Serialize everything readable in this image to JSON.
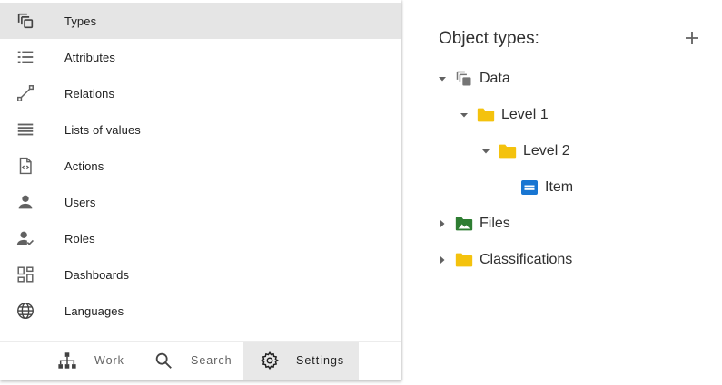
{
  "nav": {
    "items": [
      {
        "label": "Types",
        "icon": "types-icon",
        "active": true
      },
      {
        "label": "Attributes",
        "icon": "attributes-list-icon"
      },
      {
        "label": "Relations",
        "icon": "relations-icon"
      },
      {
        "label": "Lists of values",
        "icon": "lists-icon"
      },
      {
        "label": "Actions",
        "icon": "actions-file-code-icon"
      },
      {
        "label": "Users",
        "icon": "user-icon"
      },
      {
        "label": "Roles",
        "icon": "roles-user-check-icon"
      },
      {
        "label": "Dashboards",
        "icon": "dashboard-icon"
      },
      {
        "label": "Languages",
        "icon": "globe-icon"
      }
    ]
  },
  "bottom_nav": {
    "work": "Work",
    "search": "Search",
    "settings": "Settings",
    "active": "settings"
  },
  "object_types": {
    "title": "Object types:",
    "add_icon": "plus-icon",
    "tree": [
      {
        "label": "Data",
        "icon": "types-filled-icon",
        "expanded": true
      },
      {
        "label": "Level 1",
        "icon": "folder-icon",
        "expanded": true
      },
      {
        "label": "Level 2",
        "icon": "folder-icon",
        "expanded": true
      },
      {
        "label": "Item",
        "icon": "item-doc-icon"
      },
      {
        "label": "Files",
        "icon": "image-folder-icon",
        "expanded": false
      },
      {
        "label": "Classifications",
        "icon": "folder-icon",
        "expanded": false
      }
    ]
  },
  "colors": {
    "folder": "#f4c20d",
    "files_folder": "#2e7d32",
    "item": "#1976d2",
    "active_bg": "#e5e5e5",
    "icon_gray": "#616161"
  }
}
